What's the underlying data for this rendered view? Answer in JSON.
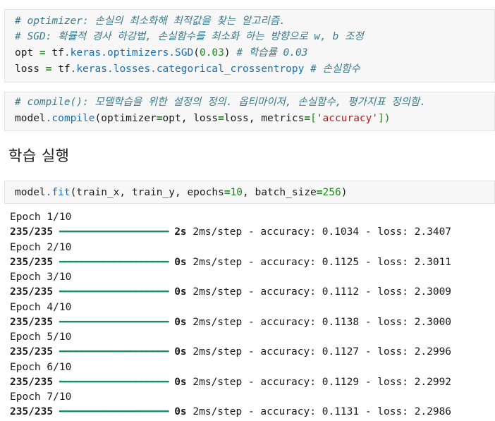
{
  "cells": {
    "optimizer": {
      "comment1": "# optimizer: 손실의 최소화해 최적값을 찾는 알고리즘.",
      "comment2": "# SGD: 확률적 경사 하강법, 손실함수를 최소화 하는 방향으로 w, b 조정",
      "line3_var": "opt",
      "line3_eq": " = ",
      "line3_a": "tf",
      "line3_b": ".keras",
      "line3_c": ".optimizers",
      "line3_d": ".SGD",
      "line3_e": "(",
      "line3_num": "0.03",
      "line3_f": ")",
      "line3_comment": " # 학습률 0.03",
      "line4_var": "loss",
      "line4_eq": " = ",
      "line4_a": "tf",
      "line4_b": ".keras",
      "line4_c": ".losses",
      "line4_d": ".categorical_crossentropy",
      "line4_comment": " # 손실함수"
    },
    "compile": {
      "comment": "# compile(): 모델학습을 위한 설정의 정의. 옵티마이저, 손실함수, 평가지표 정의함.",
      "code_a": "model",
      "code_b": ".compile",
      "code_c": "(optimizer",
      "code_eq1": "=",
      "code_d": "opt, loss",
      "code_eq2": "=",
      "code_e": "loss, metrics",
      "code_eq3": "=",
      "code_f": "[",
      "code_str": "'accuracy'",
      "code_g": "])"
    },
    "fit": {
      "code_a": "model",
      "code_b": ".fit",
      "code_c": "(train_x, train_y, epochs",
      "code_eq1": "=",
      "code_num1": "10",
      "code_d": ", batch_size",
      "code_eq2": "=",
      "code_num2": "256",
      "code_e": ")"
    }
  },
  "heading": "학습 실행",
  "output": {
    "bar": "━━━━━━━━━━━━━━━━━━━━",
    "epochs": [
      {
        "epoch": "Epoch 1/10",
        "steps": "235/235",
        "time": "2s",
        "rest": " 2ms/step - accuracy: 0.1034 - loss: 2.3407"
      },
      {
        "epoch": "Epoch 2/10",
        "steps": "235/235",
        "time": "0s",
        "rest": " 2ms/step - accuracy: 0.1125 - loss: 2.3011"
      },
      {
        "epoch": "Epoch 3/10",
        "steps": "235/235",
        "time": "0s",
        "rest": " 2ms/step - accuracy: 0.1112 - loss: 2.3009"
      },
      {
        "epoch": "Epoch 4/10",
        "steps": "235/235",
        "time": "0s",
        "rest": " 2ms/step - accuracy: 0.1138 - loss: 2.3000"
      },
      {
        "epoch": "Epoch 5/10",
        "steps": "235/235",
        "time": "0s",
        "rest": " 2ms/step - accuracy: 0.1127 - loss: 2.2996"
      },
      {
        "epoch": "Epoch 6/10",
        "steps": "235/235",
        "time": "0s",
        "rest": " 2ms/step - accuracy: 0.1129 - loss: 2.2992"
      },
      {
        "epoch": "Epoch 7/10",
        "steps": "235/235",
        "time": "0s",
        "rest": " 2ms/step - accuracy: 0.1131 - loss: 2.2986"
      }
    ]
  }
}
